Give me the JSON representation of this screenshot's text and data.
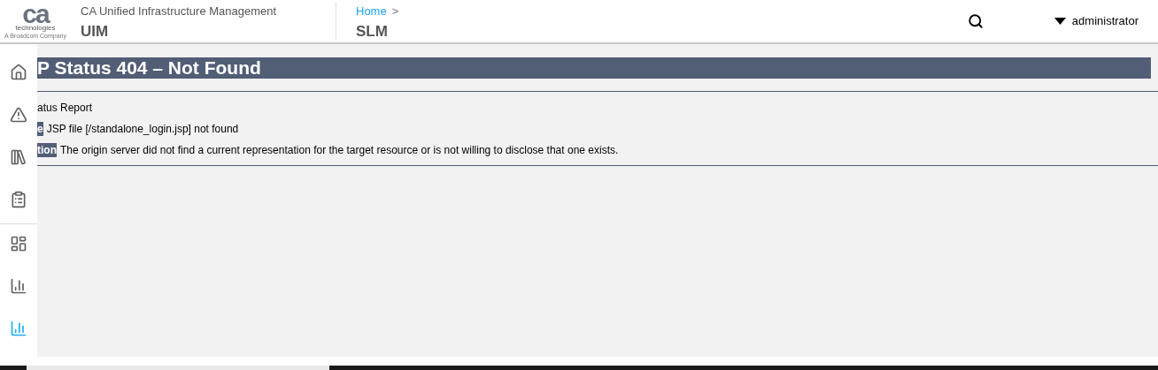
{
  "header": {
    "logo": {
      "mark": "ca",
      "name": "technologies",
      "tagline": "A Broadcom Company"
    },
    "product": "CA Unified Infrastructure Management",
    "product_short": "UIM",
    "breadcrumb": {
      "link": "Home",
      "separator": ">",
      "current": "SLM"
    },
    "user": "administrator"
  },
  "sidebar": {
    "items": [
      {
        "kind": "home",
        "selected": false
      },
      {
        "kind": "alarm",
        "selected": false
      },
      {
        "kind": "library",
        "selected": false
      },
      {
        "kind": "report",
        "selected": false
      },
      {
        "kind": "dashboard",
        "selected": false
      },
      {
        "kind": "chart",
        "selected": false
      },
      {
        "kind": "slm",
        "selected": true
      }
    ]
  },
  "error": {
    "heading": "P Status 404 – Not Found",
    "rows": [
      {
        "label": "",
        "text": "atus Report"
      },
      {
        "label": "e",
        "text": "JSP file [/standalone_login.jsp] not found"
      },
      {
        "label": "tion",
        "text": "The origin server did not find a current representation for the target resource or is not willing to disclose that one exists."
      }
    ]
  }
}
